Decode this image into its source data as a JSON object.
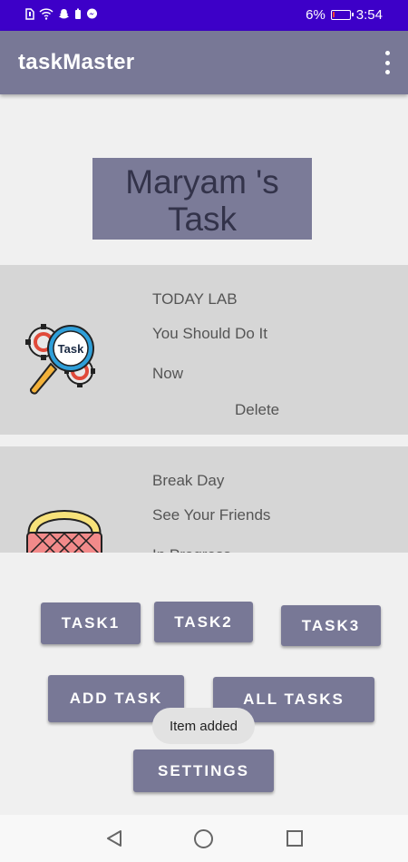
{
  "status_bar": {
    "battery_percent": "6%",
    "time": "3:54"
  },
  "app_bar": {
    "title": "taskMaster",
    "menu_icon": "overflow-menu-icon"
  },
  "heading": {
    "line1": "Maryam 's",
    "line2": "Task"
  },
  "tasks": [
    {
      "title": "TODAY LAB",
      "body": "You Should Do It",
      "state": "Now",
      "delete_label": "Delete",
      "icon": "task-gears-magnifier-icon",
      "icon_label": "Task"
    },
    {
      "title": "Break Day",
      "body": "See Your Friends",
      "state": "In Progress",
      "icon": "picnic-basket-icon"
    }
  ],
  "buttons": {
    "task1": "TASK1",
    "task2": "TASK2",
    "task3": "TASK3",
    "add_task": "ADD TASK",
    "all_tasks": "ALL TASKS",
    "settings": "SETTINGS"
  },
  "toast": {
    "message": "Item added"
  },
  "colors": {
    "status_bar": "#3d00c8",
    "primary": "#787896",
    "card": "#d6d6d6",
    "background": "#f0f0f0"
  }
}
